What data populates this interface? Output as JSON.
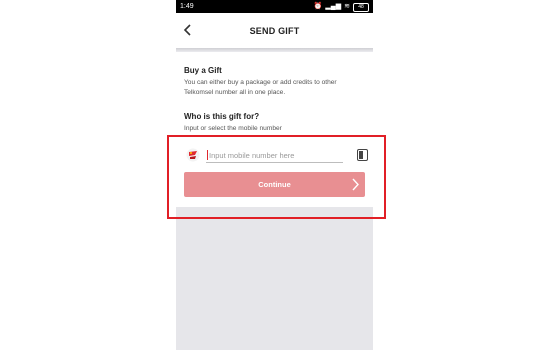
{
  "status_bar": {
    "time": "1:49",
    "battery": "48"
  },
  "header": {
    "title": "SEND GIFT"
  },
  "buy_gift": {
    "title": "Buy a Gift",
    "description": "You can either buy a package or add credits to other Telkomsel number all in one place."
  },
  "recipient": {
    "title": "Who is this gift for?",
    "subtitle": "Input or select the mobile number",
    "input_placeholder": "Input mobile number here",
    "input_value": ""
  },
  "continue_button": {
    "label": "Continue",
    "color": "#e88f92"
  },
  "icons": [
    "back-arrow-icon",
    "telkomsel-logo-icon",
    "contacts-icon",
    "chevron-right-icon"
  ],
  "colors": {
    "highlight": "#e11f26",
    "accent": "#e0282f"
  }
}
